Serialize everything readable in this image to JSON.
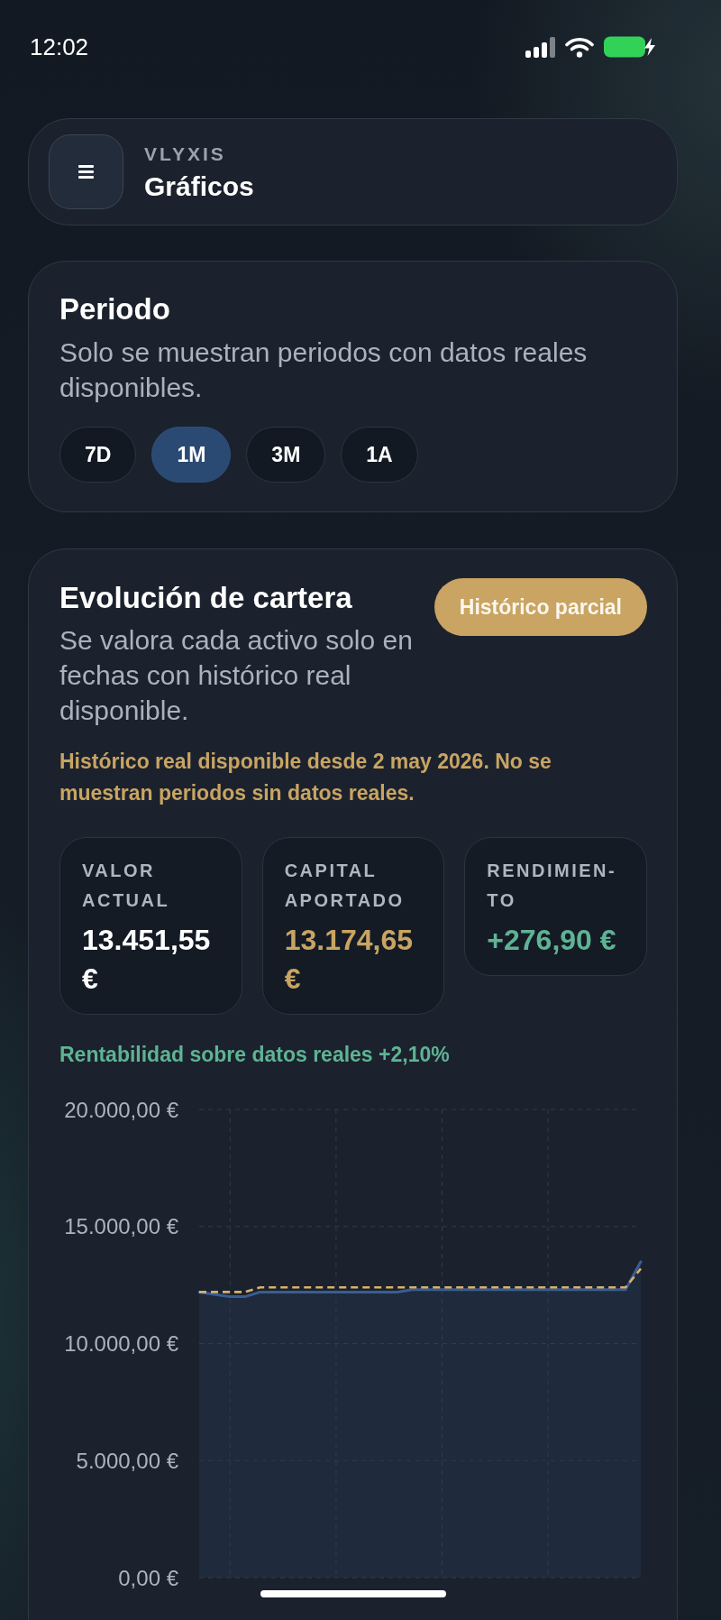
{
  "status_bar": {
    "time": "12:02"
  },
  "header": {
    "brand": "VLYXIS",
    "title": "Gráficos"
  },
  "period": {
    "title": "Periodo",
    "subtitle": "Solo se muestran periodos con datos reales disponibles.",
    "options": [
      {
        "label": "7D",
        "selected": false
      },
      {
        "label": "1M",
        "selected": true
      },
      {
        "label": "3M",
        "selected": false
      },
      {
        "label": "1A",
        "selected": false
      }
    ]
  },
  "portfolio": {
    "title": "Evolución de cartera",
    "badge": "Histórico parcial",
    "subtitle": "Se valora cada activo solo en fechas con histórico real disponible.",
    "notice": "Histórico real disponible desde 2 may 2026. No se muestran periodos sin datos reales.",
    "stats": [
      {
        "label": "VALOR ACTUAL",
        "value": "13.451,55 €",
        "color": "#ffffff"
      },
      {
        "label": "CAPITAL APORTADO",
        "value": "13.174,65 €",
        "color": "#c9a462"
      },
      {
        "label": "RENDIMIEN-TO",
        "value": "+276,90 €",
        "color": "#5fb394"
      }
    ],
    "return_note": "Rentabilidad sobre datos reales +2,10%",
    "chart_data": {
      "type": "area",
      "grid": true,
      "ylim": [
        0,
        20000
      ],
      "yticks": [
        {
          "value": 0,
          "label": "0,00 €"
        },
        {
          "value": 5000,
          "label": "5.000,00 €"
        },
        {
          "value": 10000,
          "label": "10.000,00 €"
        },
        {
          "value": 15000,
          "label": "15.000,00 €"
        },
        {
          "value": 20000,
          "label": "20.000,00 €"
        }
      ],
      "series": [
        {
          "color": "#3a5d92",
          "values": [
            12200,
            12100,
            12000,
            12000,
            12200,
            12200,
            12200,
            12200,
            12200,
            12200,
            12200,
            12200,
            12200,
            12200,
            12300,
            12300,
            12300,
            12300,
            12300,
            12300,
            12300,
            12300,
            12300,
            12300,
            12300,
            12300,
            12300,
            12300,
            12300,
            13500
          ]
        },
        {
          "type": "line",
          "line_style": "dashed",
          "color": "#d6b26c",
          "values": [
            12200,
            12200,
            12200,
            12200,
            12400,
            12400,
            12400,
            12400,
            12400,
            12400,
            12400,
            12400,
            12400,
            12400,
            12400,
            12400,
            12400,
            12400,
            12400,
            12400,
            12400,
            12400,
            12400,
            12400,
            12400,
            12400,
            12400,
            12400,
            12400,
            13200
          ]
        }
      ]
    }
  }
}
